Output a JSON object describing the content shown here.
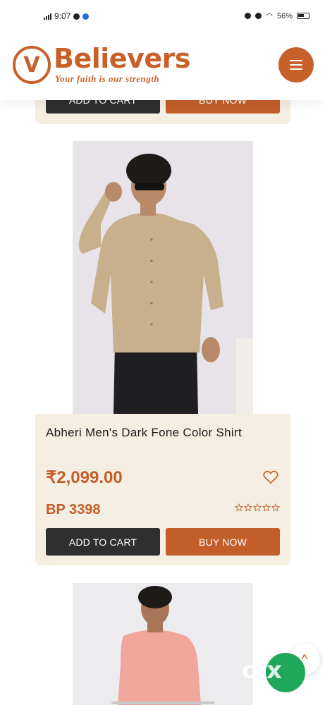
{
  "status_bar": {
    "time": "9:07",
    "battery_percent": "56%"
  },
  "header": {
    "logo_letter": "V",
    "brand_name": "Believers",
    "tagline": "Your faith is our strength"
  },
  "previous_card": {
    "add_to_cart_label": "ADD TO CART",
    "buy_now_label": "BUY NOW"
  },
  "product": {
    "title": "Abheri Men's Dark Fone Color Shirt",
    "price": "₹2,099.00",
    "bp": "BP 3398",
    "rating": 0,
    "max_rating": 5,
    "add_to_cart_label": "ADD TO CART",
    "buy_now_label": "BUY NOW",
    "shirt_color": "#c8b08c"
  },
  "next_product": {
    "shirt_color": "#f0a69a"
  },
  "overlay": {
    "olx_logo": "olx"
  },
  "colors": {
    "accent": "#c35e29",
    "card_bg": "#f5eee2",
    "dark_button": "#2f2f2f"
  }
}
